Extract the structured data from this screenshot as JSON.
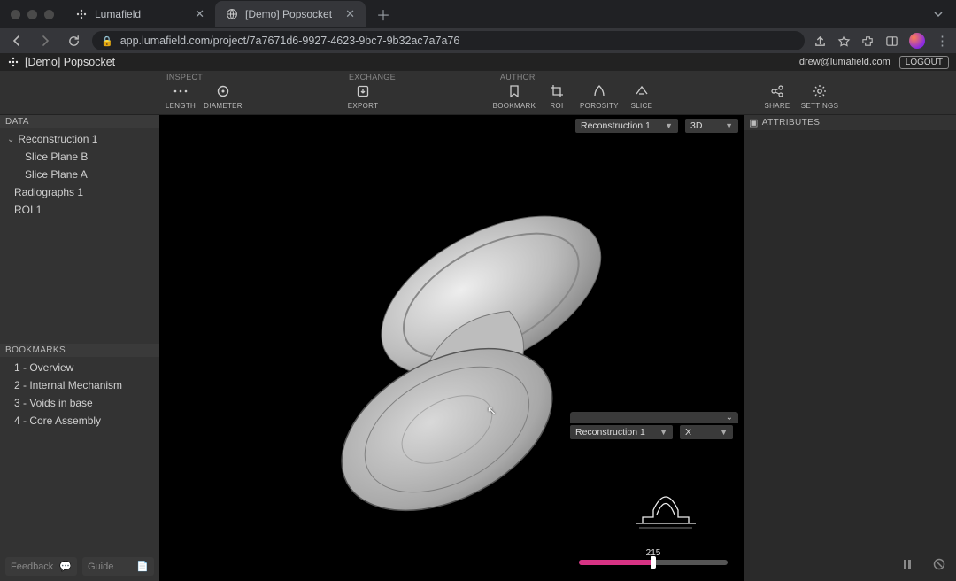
{
  "browser": {
    "tabs": [
      {
        "title": "Lumafield",
        "active": false
      },
      {
        "title": "[Demo] Popsocket",
        "active": true
      }
    ],
    "url": "app.lumafield.com/project/7a7671d6-9927-4623-9bc7-9b32ac7a7a76"
  },
  "app": {
    "title": "[Demo] Popsocket",
    "user_email": "drew@lumafield.com",
    "logout_label": "LOGOUT"
  },
  "toolbar": {
    "groups": {
      "inspect": {
        "label": "INSPECT",
        "items": {
          "length": "LENGTH",
          "diameter": "DIAMETER"
        }
      },
      "exchange": {
        "label": "EXCHANGE",
        "items": {
          "export": "EXPORT"
        }
      },
      "author": {
        "label": "AUTHOR",
        "items": {
          "bookmark": "BOOKMARK",
          "roi": "ROI",
          "porosity": "POROSITY",
          "slice": "SLICE"
        }
      },
      "right": {
        "share": "SHARE",
        "settings": "SETTINGS"
      }
    }
  },
  "sidebar": {
    "data_label": "DATA",
    "data_tree": {
      "root": "Reconstruction 1",
      "children": [
        "Slice Plane B",
        "Slice Plane A"
      ],
      "siblings": [
        "Radiographs 1",
        "ROI 1"
      ]
    },
    "bookmarks_label": "BOOKMARKS",
    "bookmarks": [
      "1 - Overview",
      "2 - Internal Mechanism",
      "3 - Voids in base",
      "4 - Core Assembly"
    ],
    "footer": {
      "feedback": "Feedback",
      "guide": "Guide"
    }
  },
  "viewport": {
    "top_dd1": "Reconstruction 1",
    "top_dd2": "3D",
    "inset_dd1": "Reconstruction 1",
    "inset_dd2": "X",
    "slider_value": "215"
  },
  "attributes": {
    "label": "ATTRIBUTES"
  }
}
